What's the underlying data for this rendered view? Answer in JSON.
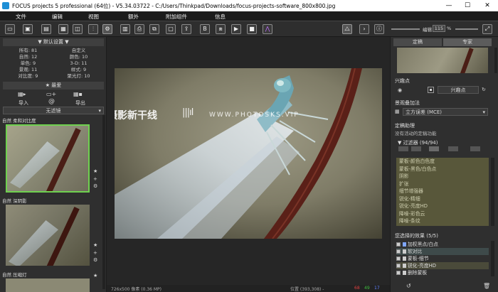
{
  "window": {
    "title": "FOCUS projects 5 professional (64位) - V5.34.03722 - C:/Users/Thinkpad/Downloads/focus-projects-software_800x800.jpg",
    "minimize": "—",
    "maximize": "☐",
    "close": "✕"
  },
  "menu": [
    "文件",
    "编辑",
    "视图",
    "额外",
    "附加组件",
    "信息"
  ],
  "toolbar": {
    "zoom_label": "编辑",
    "zoom_value": "115",
    "zoom_unit": "%"
  },
  "left": {
    "preset_header": "▼ 默认设置 ▼",
    "categories": [
      [
        "所有: 81",
        "自定义"
      ],
      [
        "自然: 12",
        "颜色: 10"
      ],
      [
        "单色: 9",
        "3-D: 11"
      ],
      [
        "景观: 11",
        "样式: 9"
      ],
      [
        "对比度: 9",
        "聚光灯: 10"
      ]
    ],
    "favorite": "★ 最爱",
    "import_label": "导入",
    "export_label": "导出",
    "filter_select": "无滤镜",
    "thumbs": [
      "自然 柔和对比度",
      "自然 深阴影",
      "自然 压缩灯"
    ]
  },
  "canvas": {
    "watermark": "摄影新干线",
    "watermark_url": "WWW.PHOTOSKS.VIP",
    "status_left": "726x500 像素 (0.36 MP)",
    "status_pos": "位置 (393,308) -",
    "status_r": "68",
    "status_g": "49",
    "status_b": "17"
  },
  "right": {
    "tabs": [
      "定稿",
      "专家"
    ],
    "interest_label": "兴趣点",
    "interest_value": "兴趣点",
    "overlay_label": "景观叠加法",
    "overlay_select": "立方误差 (MCE)",
    "process_label": "定稿助理",
    "process_note": "没有活动的定稿功能",
    "filters_header": "▼ 过滤器 (94/94)",
    "filters": [
      "蒙板-颜色白色度",
      "蒙板-黑色/白色点",
      "阴影",
      "扩张",
      "细节增强器",
      "锐化-精细",
      "锐化-亮度HD",
      "降噪-彩色云",
      "降噪-条纹"
    ],
    "effects_header": "您选择的效果 (5/5)",
    "effects": [
      "加权黑点/白点",
      "软对比",
      "蒙板-细节",
      "锐化-亮度HD",
      "删除蒙板"
    ]
  },
  "colors": {
    "accent_green": "#6fd14f",
    "filter_bg": "#58573a",
    "status_red": "#e04040",
    "status_green": "#40c040",
    "status_blue": "#6080ff"
  }
}
